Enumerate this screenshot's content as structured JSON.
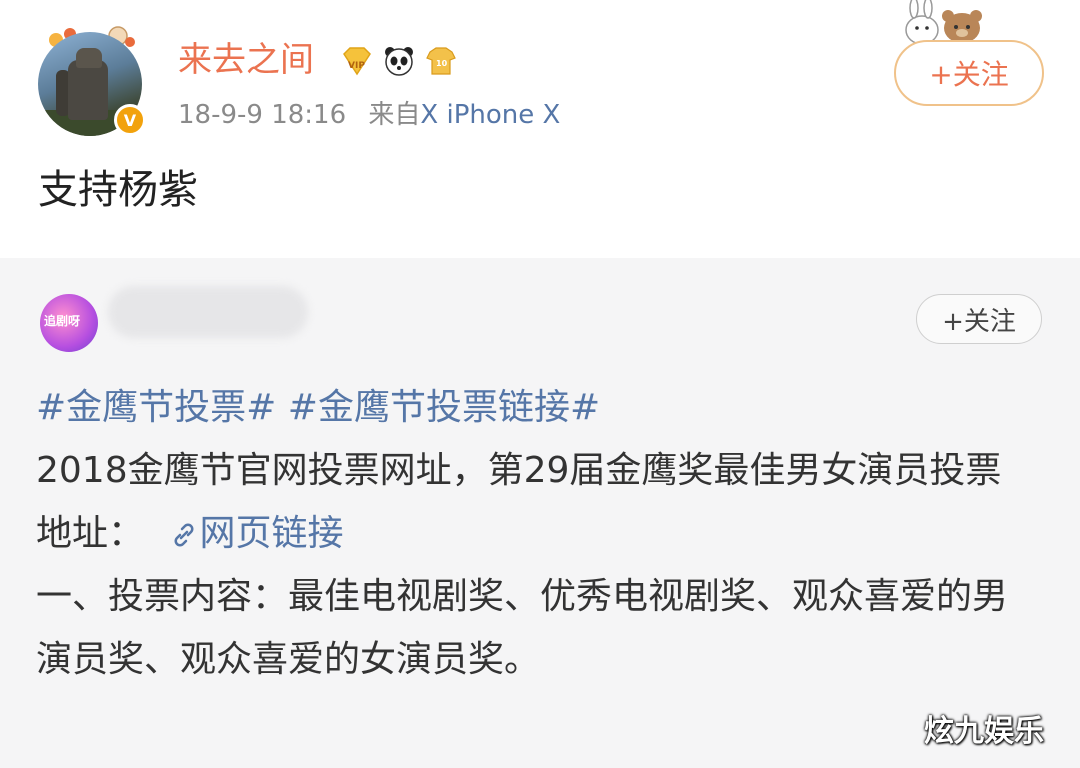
{
  "post": {
    "username": "来去之间",
    "timestamp": "18-9-9 18:16",
    "source_prefix": "来自",
    "source_device": "X iPhone X",
    "follow_label": "+关注",
    "text": "支持杨紫",
    "verified_mark": "V",
    "badge_icons": [
      "vip-icon",
      "panda-icon",
      "shirt-badge-icon"
    ],
    "accent_color": "#eb7350"
  },
  "repost": {
    "follow_label": "+关注",
    "avatar_text": "追剧呀",
    "hashtags": [
      "#金鹰节投票#",
      "#金鹰节投票链接#"
    ],
    "line1": "2018金鹰节官网投票网址，第29届金鹰奖最佳男女演员投票地址：",
    "link_text": "网页链接",
    "line2": "一、投票内容：最佳电视剧奖、优秀电视剧奖、观众喜爱的男演员奖、观众喜爱的女演员奖。",
    "link_color": "#5576a7"
  },
  "watermark": "炫九娱乐"
}
